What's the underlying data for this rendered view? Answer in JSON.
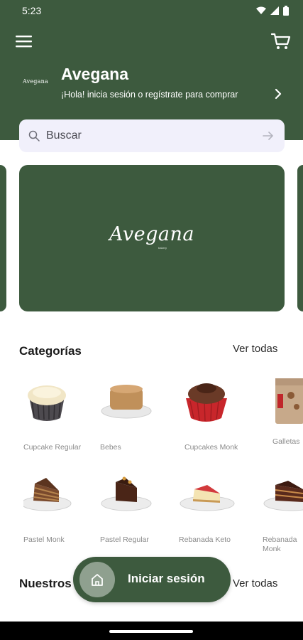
{
  "status": {
    "time": "5:23"
  },
  "header": {
    "brand_logo_text": "Avegana",
    "title": "Avegana",
    "subtitle": "¡Hola! inicia sesión o regístrate para comprar"
  },
  "search": {
    "placeholder": "Buscar"
  },
  "banner": {
    "logo_text": "Avegana",
    "tagline": "bakery"
  },
  "categories": {
    "title": "Categorías",
    "see_all": "Ver todas",
    "items": [
      {
        "label": "Cupcake Regular",
        "icon": "cupcake"
      },
      {
        "label": "Bebes",
        "icon": "mini-cake"
      },
      {
        "label": "Cupcakes Monk",
        "icon": "chocolate-cupcake"
      },
      {
        "label": "Galletas",
        "icon": "cookie-bag"
      },
      {
        "label": "Pastel Monk",
        "icon": "cake-slice"
      },
      {
        "label": "Pastel Regular",
        "icon": "chocolate-cake-slice"
      },
      {
        "label": "Rebanada Keto",
        "icon": "cheesecake-slice"
      },
      {
        "label": "Rebanada Monk",
        "icon": "layer-cake-slice"
      }
    ]
  },
  "section2": {
    "title": "Nuestros",
    "see_all": "Ver todas"
  },
  "login_button": {
    "label": "Iniciar sesión"
  },
  "colors": {
    "primary": "#3d5a3e",
    "search_bg": "#f1f0fb",
    "muted_text": "#8a8a8a"
  }
}
